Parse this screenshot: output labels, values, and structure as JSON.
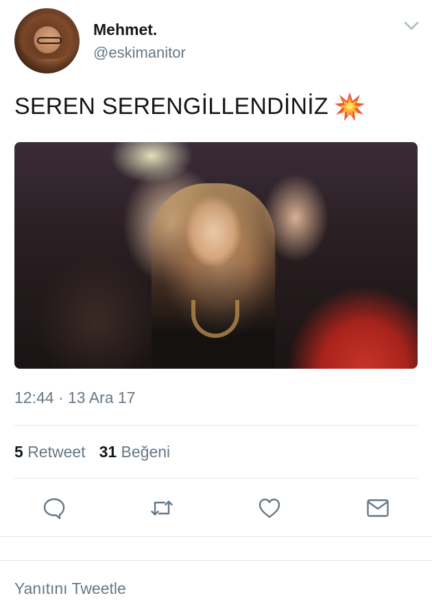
{
  "author": {
    "display_name": "Mehmet.",
    "handle": "@eskimanitor"
  },
  "tweet": {
    "text": "SEREN SERENGİLLENDİNİZ",
    "emoji": "collision-icon",
    "timestamp": "12:44 · 13 Ara 17"
  },
  "stats": {
    "retweets_count": "5",
    "retweets_label": "Retweet",
    "likes_count": "31",
    "likes_label": "Beğeni"
  },
  "actions": [
    {
      "name": "reply",
      "icon": "reply-icon"
    },
    {
      "name": "retweet",
      "icon": "retweet-icon"
    },
    {
      "name": "like",
      "icon": "heart-icon"
    },
    {
      "name": "dm",
      "icon": "mail-icon"
    }
  ],
  "reply_box": {
    "placeholder": "Yanıtını Tweetle"
  },
  "colors": {
    "primary_text": "#14171a",
    "secondary_text": "#657786",
    "divider": "#e1e8ed",
    "icon": "#657786"
  }
}
